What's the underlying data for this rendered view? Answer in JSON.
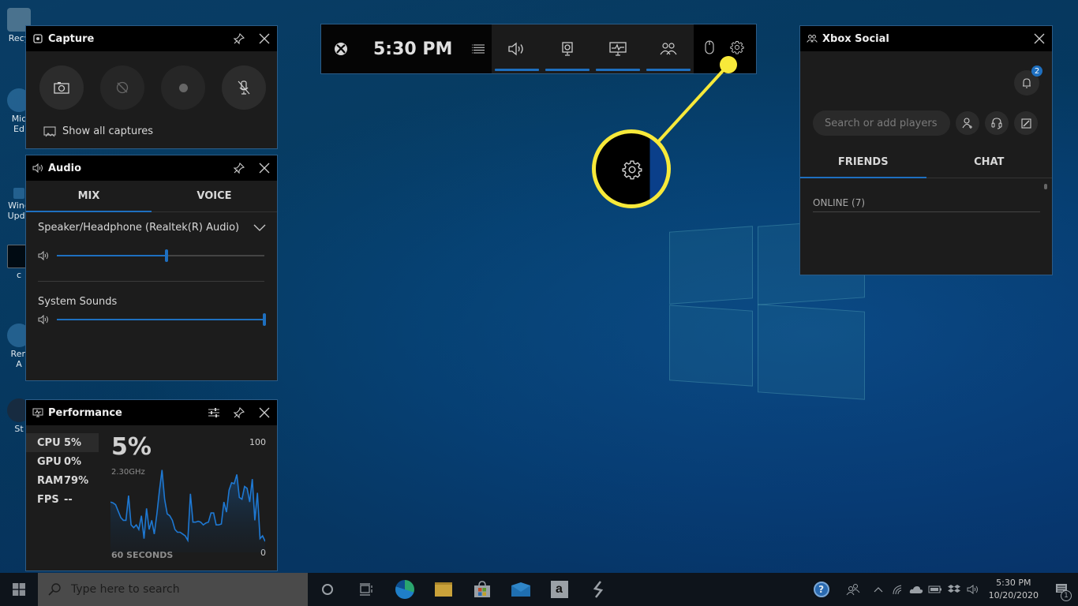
{
  "desktop": {
    "icons": [
      {
        "label": "Recy",
        "icon": "recycle-bin-icon"
      },
      {
        "label": "Mic\nEd",
        "icon": "edge-shortcut-icon"
      },
      {
        "label": "Wind\nUpda",
        "icon": "windows-update-shortcut-icon"
      },
      {
        "label": "c",
        "icon": "cmd-shortcut-icon"
      },
      {
        "label": "Ren\nA",
        "icon": "app-shortcut-icon"
      },
      {
        "label": "St",
        "icon": "steam-shortcut-icon"
      }
    ]
  },
  "capture": {
    "title": "Capture",
    "buttons": [
      {
        "name": "screenshot",
        "icon": "camera-icon"
      },
      {
        "name": "record-last-30s",
        "icon": "record-that-icon"
      },
      {
        "name": "start-recording",
        "icon": "record-dot-icon"
      },
      {
        "name": "mic-toggle",
        "icon": "mic-off-icon"
      }
    ],
    "show_all_label": "Show all captures"
  },
  "audio": {
    "title": "Audio",
    "tabs": [
      {
        "label": "MIX",
        "active": true
      },
      {
        "label": "VOICE",
        "active": false
      }
    ],
    "device": "Speaker/Headphone (Realtek(R) Audio)",
    "device_volume": 0.53,
    "system_sounds_label": "System Sounds",
    "system_sounds_volume": 1.0
  },
  "performance": {
    "title": "Performance",
    "metrics": [
      {
        "label": "CPU",
        "value": "5%",
        "active": true
      },
      {
        "label": "GPU",
        "value": "0%",
        "active": false
      },
      {
        "label": "RAM",
        "value": "79%",
        "active": false
      },
      {
        "label": "FPS",
        "value": "--",
        "active": false
      }
    ],
    "current": "5%",
    "frequency": "2.30GHz",
    "max_label": "100",
    "min_label": "0",
    "duration_label": "60 SECONDS"
  },
  "chart_data": {
    "type": "area",
    "title": "CPU",
    "xlabel": "60 SECONDS",
    "ylabel": "",
    "ylim": [
      0,
      100
    ],
    "series": [
      {
        "name": "CPU usage",
        "values": [
          55,
          54,
          52,
          45,
          38,
          35,
          35,
          62,
          30,
          27,
          30,
          25,
          40,
          15,
          48,
          25,
          35,
          20,
          42,
          68,
          90,
          58,
          42,
          40,
          35,
          25,
          22,
          22,
          20,
          18,
          13,
          64,
          33,
          33,
          34,
          33,
          30,
          32,
          33,
          43,
          43,
          30,
          30,
          31,
          55,
          44,
          68,
          76,
          75,
          85,
          60,
          58,
          72,
          70,
          55,
          80,
          35,
          65,
          15,
          18,
          12
        ]
      }
    ],
    "color": "#1e78d2"
  },
  "gamebar": {
    "time": "5:30 PM",
    "widgets": [
      {
        "name": "audio",
        "icon": "speaker-icon"
      },
      {
        "name": "capture",
        "icon": "capture-widget-icon"
      },
      {
        "name": "performance",
        "icon": "performance-monitor-icon"
      },
      {
        "name": "social",
        "icon": "people-icon"
      }
    ]
  },
  "social": {
    "title": "Xbox Social",
    "notifications": "2",
    "search_placeholder": "Search or add players",
    "tabs": [
      {
        "label": "FRIENDS",
        "active": true
      },
      {
        "label": "CHAT",
        "active": false
      }
    ],
    "online_label": "ONLINE  (7)"
  },
  "taskbar": {
    "search_placeholder": "Type here to search",
    "apps": [
      "cortana-icon",
      "task-view-icon",
      "edge-icon",
      "file-explorer-icon",
      "store-icon",
      "mail-icon",
      "amazon-icon",
      "app-s-icon"
    ],
    "time": "5:30 PM",
    "date": "10/20/2020",
    "notification_count": "1"
  },
  "colors": {
    "accent": "#1e6fbf",
    "callout": "#f7e93a"
  }
}
